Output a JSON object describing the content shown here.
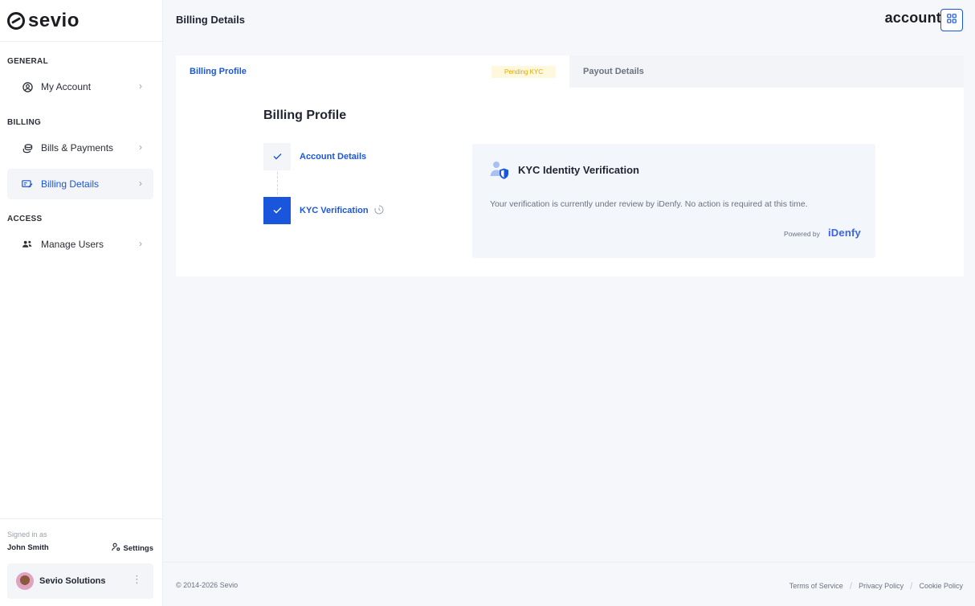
{
  "brand": {
    "name": "sevio"
  },
  "sidebar": {
    "sections": [
      {
        "label": "GENERAL"
      },
      {
        "label": "BILLING"
      },
      {
        "label": "ACCESS"
      }
    ],
    "items": [
      {
        "label": "My Account",
        "icon": "user-circle-icon"
      },
      {
        "label": "Bills & Payments",
        "icon": "coins-icon"
      },
      {
        "label": "Billing Details",
        "icon": "billing-card-icon",
        "active": true
      },
      {
        "label": "Manage Users",
        "icon": "users-icon"
      }
    ],
    "footer": {
      "signed_in_label": "Signed in as",
      "user_name": "John Smith",
      "settings_label": "Settings",
      "org_name": "Sevio Solutions"
    }
  },
  "header": {
    "title": "Billing Details",
    "account_label": "account"
  },
  "card": {
    "tabs": [
      {
        "label": "Billing Profile",
        "active": true,
        "badge": "Pending KYC"
      },
      {
        "label": "Payout Details",
        "active": false
      }
    ],
    "profile_title": "Billing Profile",
    "steps": [
      {
        "label": "Account Details",
        "status": "complete"
      },
      {
        "label": "KYC Verification",
        "status": "pending"
      }
    ],
    "kyc": {
      "title": "KYC Identity Verification",
      "description": "Your verification is currently under review by iDenfy. No action is required at this time.",
      "powered_by": "Powered by",
      "provider": "iDenfy"
    }
  },
  "footer": {
    "copyright": "© 2014-2026 Sevio",
    "links": [
      "Terms of Service",
      "Privacy Policy",
      "Cookie Policy"
    ]
  },
  "colors": {
    "accent": "#1a56db",
    "pending_bg": "#fff8dc",
    "pending_text": "#e0a800"
  }
}
